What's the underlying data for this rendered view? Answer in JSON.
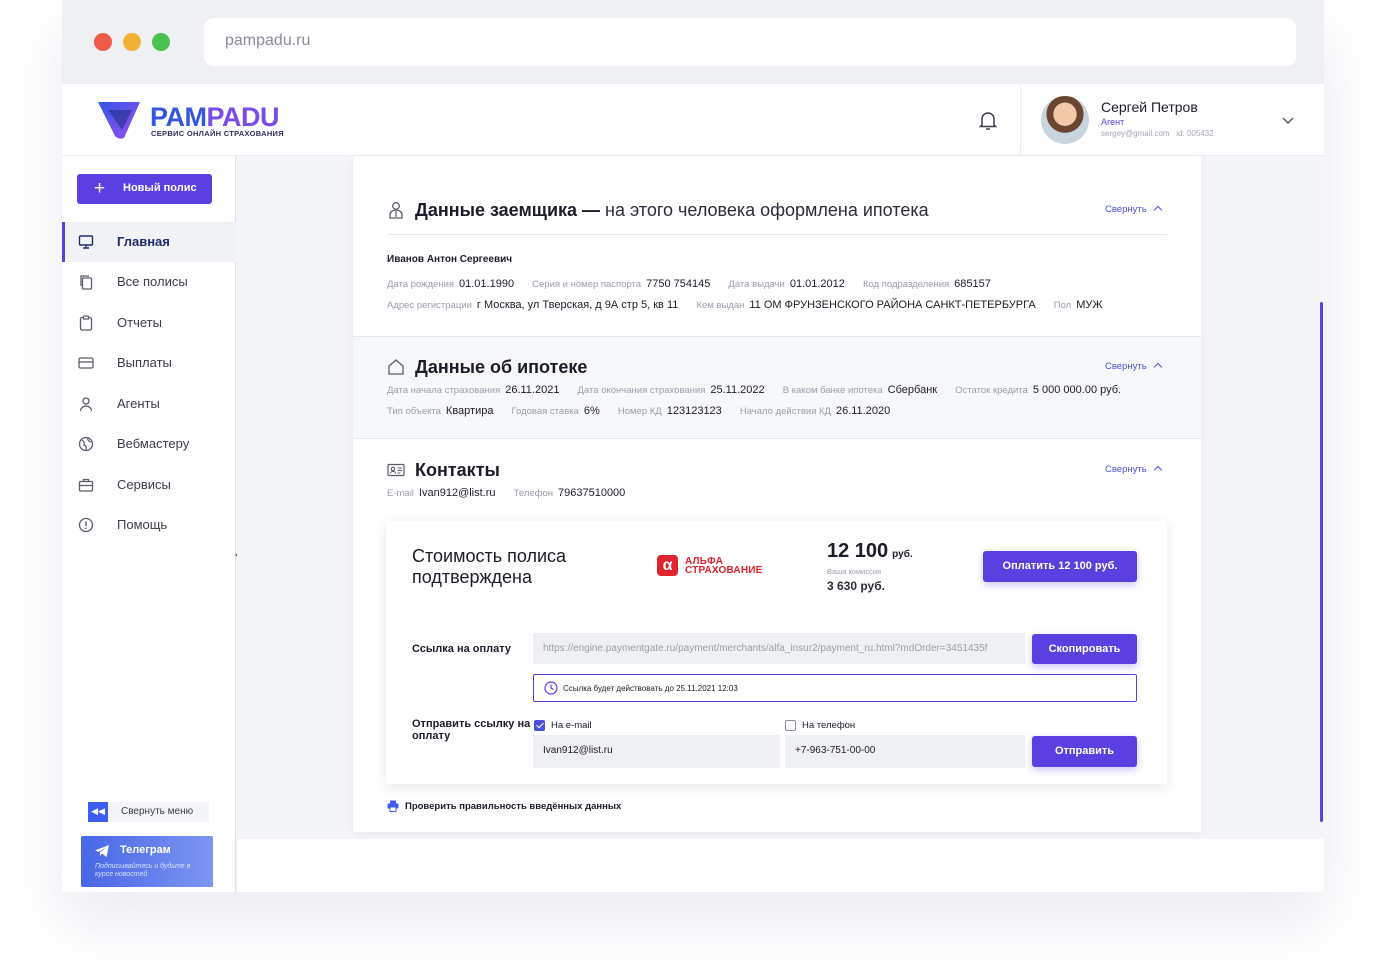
{
  "browser": {
    "url": "pampadu.ru",
    "dots": [
      "#f05a4a",
      "#f2b233",
      "#49c24f"
    ]
  },
  "brand": {
    "name_part1": "PAM",
    "name_part2": "PADU",
    "tagline": "СЕРВИС ОНЛАЙН СТРАХОВАНИЯ"
  },
  "user": {
    "name": "Сергей Петров",
    "role": "Агент",
    "email": "sergey@gmail.com",
    "id": "id: 005432"
  },
  "sidebar": {
    "new_policy": "Новый полис",
    "items": [
      {
        "label": "Главная",
        "icon": "monitor-icon",
        "active": true
      },
      {
        "label": "Все полисы",
        "icon": "copy-icon"
      },
      {
        "label": "Отчеты",
        "icon": "clipboard-icon"
      },
      {
        "label": "Выплаты",
        "icon": "card-icon"
      },
      {
        "label": "Агенты",
        "icon": "person-icon"
      },
      {
        "label": "Вебмастеру",
        "icon": "globe-icon"
      },
      {
        "label": "Сервисы",
        "icon": "briefcase-icon"
      },
      {
        "label": "Помощь",
        "icon": "alert-circle-icon"
      }
    ],
    "collapse_menu": "Свернуть меню",
    "telegram_title": "Телеграм",
    "telegram_text": "Подписывайтесь и будьте в курсе новостей"
  },
  "borrower": {
    "title": "Данные заемщика —",
    "title_rest": " на этого человека оформлена ипотека",
    "collapse": "Свернуть",
    "full_name": "Иванов Антон Сергеевич",
    "birth_label": "Дата рождения",
    "birth": "01.01.1990",
    "passport_label": "Серия и номер паспорта",
    "passport": "7750 754145",
    "issue_date_label": "Дата выдачи",
    "issue_date": "01.01.2012",
    "dept_code_label": "Код подразделения",
    "dept_code": "685157",
    "address_label": "Адрес регистрации",
    "address": "г Москва, ул Тверская, д 9А стр 5, кв 11",
    "issued_by_label": "Кем выдан",
    "issued_by": "11 ОМ ФРУНЗЕНСКОГО РАЙОНА САНКТ-ПЕТЕРБУРГА",
    "sex_label": "Пол",
    "sex": "МУЖ"
  },
  "mortgage": {
    "title": "Данные об ипотеке",
    "collapse": "Свернуть",
    "start_label": "Дата начала страхования",
    "start": "26.11.2021",
    "end_label": "Дата окончания страхования",
    "end": "25.11.2022",
    "bank_label": "В каком банке ипотека",
    "bank": "Сбербанк",
    "balance_label": "Остаток кредита",
    "balance": "5 000 000.00 руб.",
    "object_label": "Тип объекта",
    "object": "Квартира",
    "rate_label": "Годовая ставка",
    "rate": "6%",
    "kd_num_label": "Номер КД",
    "kd_num": "123123123",
    "kd_start_label": "Начало действия КД",
    "kd_start": "26.11.2020"
  },
  "contacts": {
    "title": "Контакты",
    "collapse": "Свернуть",
    "email_label": "E-mail",
    "email": "Ivan912@list.ru",
    "phone_label": "Телефон",
    "phone": "79637510000"
  },
  "payment": {
    "title": "Стоимость полиса подтверждена",
    "insurer_line1": "АЛЬФА",
    "insurer_line2": "СТРАХОВАНИЕ",
    "insurer_mark": "α",
    "price": "12 100",
    "price_unit": "руб.",
    "commission_label": "Ваша комиссия",
    "commission": "3 630 руб.",
    "pay_button": "Оплатить 12 100 руб.",
    "link_label": "Ссылка на оплату",
    "link": "https://engine.paymentgate.ru/payment/merchants/alfa_insur2/payment_ru.html?mdOrder=3451435f",
    "copy_button": "Скопировать",
    "validity_note": "Ссылка будет действовать до 25.11.2021 12:03",
    "send_label": "Отправить ссылку на оплату",
    "email_option": "На e-mail",
    "email_checked": true,
    "phone_option": "На телефон",
    "phone_checked": false,
    "email_value": "Ivan912@list.ru",
    "phone_value": "+7-963-751-00-00",
    "send_button": "Отправить",
    "verify_link": "Проверить правильность введённых данных"
  },
  "colors": {
    "accent": "#5b3fe0",
    "alfa_red": "#e0232d",
    "link": "#4a50d8"
  }
}
